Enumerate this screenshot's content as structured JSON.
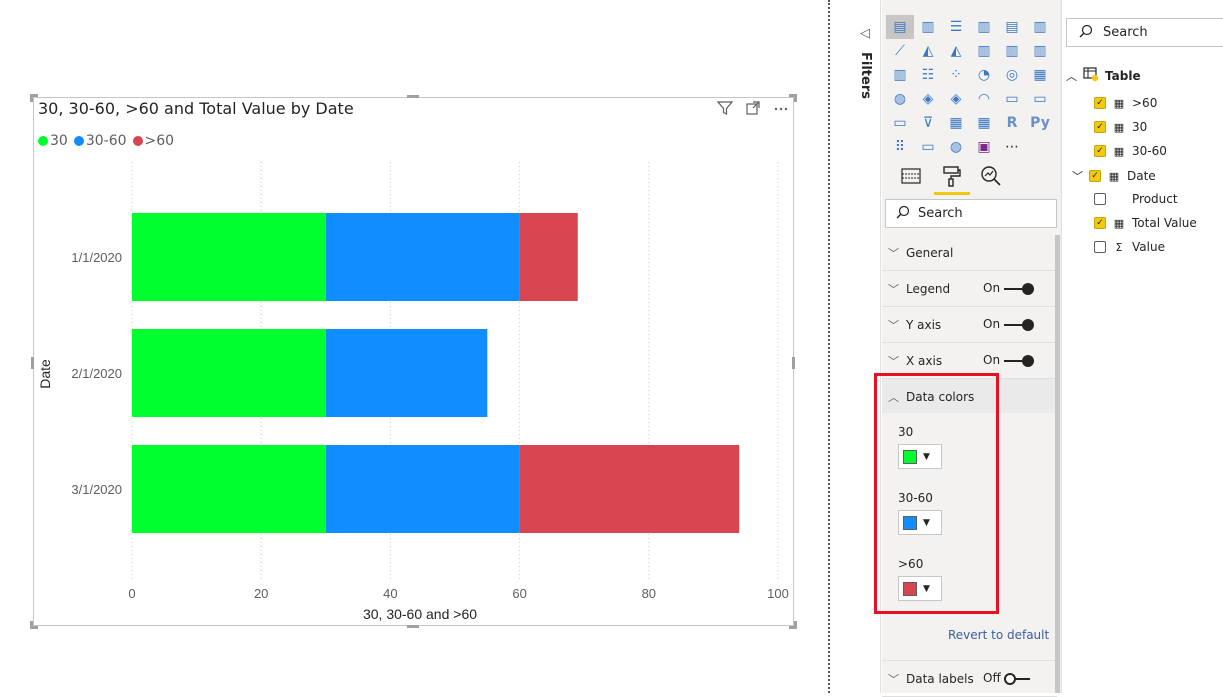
{
  "chart": {
    "title": "30, 30-60, >60 and Total Value by Date",
    "legend": [
      {
        "label": "30",
        "color": "#00ff2e"
      },
      {
        "label": "30-60",
        "color": "#118dff"
      },
      {
        "label": ">60",
        "color": "#d64550"
      }
    ],
    "tool_icons": [
      "filter-icon",
      "focus-mode-icon",
      "more-options-icon"
    ]
  },
  "chart_data": {
    "type": "bar",
    "orientation": "horizontal",
    "stacked": true,
    "categories": [
      "1/1/2020",
      "2/1/2020",
      "3/1/2020"
    ],
    "series": [
      {
        "name": "30",
        "color": "#00ff2e",
        "values": [
          30,
          30,
          30
        ]
      },
      {
        "name": "30-60",
        "color": "#118dff",
        "values": [
          30,
          25,
          30
        ]
      },
      {
        "name": ">60",
        "color": "#d64550",
        "values": [
          9,
          0,
          34
        ]
      }
    ],
    "title": "30, 30-60, >60 and Total Value by Date",
    "xlabel": "30, 30-60 and >60",
    "ylabel": "Date",
    "xlim": [
      0,
      100
    ],
    "xticks": [
      "0",
      "20",
      "40",
      "60",
      "80",
      "100"
    ],
    "grid": "vertical-dotted",
    "legend_position": "top-left"
  },
  "filters": {
    "label": "Filters"
  },
  "visualizations": {
    "icons": [
      "stacked-bar-icon",
      "stacked-column-icon",
      "clustered-bar-icon",
      "clustered-column-icon",
      "100-stacked-bar-icon",
      "100-stacked-column-icon",
      "line-chart-icon",
      "area-chart-icon",
      "stacked-area-icon",
      "line-column-icon",
      "line-clustered-column-icon",
      "ribbon-chart-icon",
      "waterfall-icon",
      "funnel-icon",
      "scatter-icon",
      "pie-chart-icon",
      "donut-chart-icon",
      "treemap-icon",
      "map-icon",
      "filled-map-icon",
      "shape-map-icon",
      "gauge-icon",
      "card-icon",
      "multi-row-card-icon",
      "kpi-icon",
      "slicer-icon",
      "table-icon",
      "matrix-icon",
      "r-visual-icon",
      "python-visual-icon",
      "key-influencers-icon",
      "qa-icon",
      "decomposition-tree-icon",
      "custom-visual-icon",
      "more-visuals-icon"
    ],
    "glyphs": [
      "▤",
      "▥",
      "☰",
      "▥",
      "▤",
      "▥",
      "⟋",
      "◭",
      "◭",
      "▥",
      "▥",
      "▥",
      "▥",
      "☷",
      "⁘",
      "◔",
      "◎",
      "▦",
      "◍",
      "◈",
      "◈",
      "◠",
      "▭",
      "▭",
      "▭",
      "⊽",
      "▦",
      "▦",
      "R",
      "Py",
      "⠿",
      "▭",
      "◍",
      "▣",
      "⋯"
    ],
    "search_placeholder": "Search",
    "tabs": [
      "fields-tab-icon",
      "format-tab-icon",
      "analytics-tab-icon"
    ],
    "sections": [
      {
        "label": "General"
      },
      {
        "label": "Legend",
        "state": "On"
      },
      {
        "label": "Y axis",
        "state": "On"
      },
      {
        "label": "X axis",
        "state": "On"
      },
      {
        "label": "Data colors"
      }
    ],
    "data_colors": [
      {
        "label": "30",
        "color": "#00ff2e"
      },
      {
        "label": "30-60",
        "color": "#118dff"
      },
      {
        "label": ">60",
        "color": "#d64550"
      }
    ],
    "revert_label": "Revert to default",
    "data_labels": {
      "label": "Data labels",
      "state": "Off"
    }
  },
  "fields": {
    "search_placeholder": "Search",
    "table_name": "Table",
    "items": [
      {
        "label": ">60",
        "checked": true,
        "icon": "calculator-icon"
      },
      {
        "label": "30",
        "checked": true,
        "icon": "calculator-icon"
      },
      {
        "label": "30-60",
        "checked": true,
        "icon": "calculator-icon"
      },
      {
        "label": "Date",
        "checked": true,
        "icon": "calendar-table-icon"
      },
      {
        "label": "Product",
        "checked": false,
        "icon": "none"
      },
      {
        "label": "Total Value",
        "checked": true,
        "icon": "calculator-icon"
      },
      {
        "label": "Value",
        "checked": false,
        "icon": "sigma-icon"
      }
    ]
  }
}
